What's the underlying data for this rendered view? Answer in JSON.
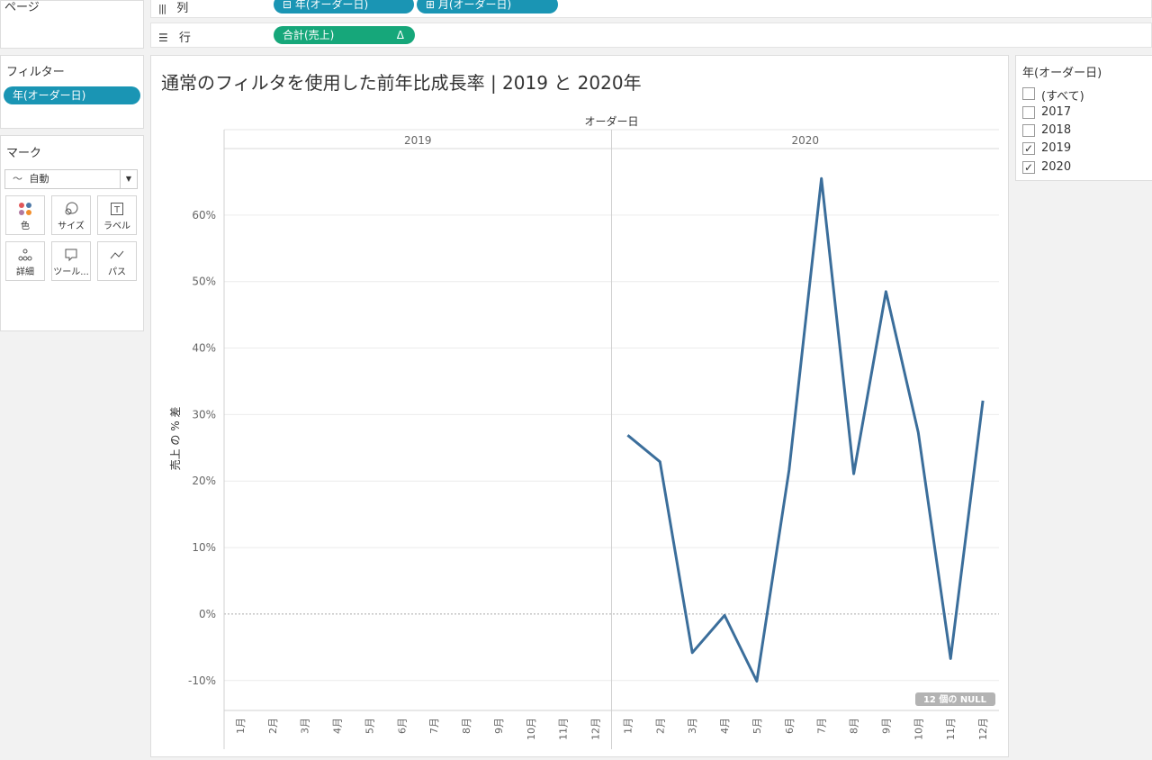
{
  "shelves": {
    "pages_label": "ページ",
    "columns_label": "列",
    "rows_label": "行",
    "column_pills": [
      "年(オーダー日)",
      "月(オーダー日)"
    ],
    "row_pill": "合計(売上)",
    "row_pill_delta": "Δ"
  },
  "filters": {
    "title": "フィルター",
    "pill": "年(オーダー日)"
  },
  "marks": {
    "title": "マーク",
    "type_selected": "自動",
    "buttons": [
      {
        "label": "色",
        "icon": "color-dots-icon"
      },
      {
        "label": "サイズ",
        "icon": "size-icon"
      },
      {
        "label": "ラベル",
        "icon": "label-icon"
      },
      {
        "label": "詳細",
        "icon": "detail-icon"
      },
      {
        "label": "ツール...",
        "icon": "tooltip-icon"
      },
      {
        "label": "パス",
        "icon": "path-icon"
      }
    ]
  },
  "quick_filter": {
    "title": "年(オーダー日)",
    "options": [
      {
        "label": "(すべて)",
        "checked": false
      },
      {
        "label": "2017",
        "checked": false
      },
      {
        "label": "2018",
        "checked": false
      },
      {
        "label": "2019",
        "checked": true
      },
      {
        "label": "2020",
        "checked": true
      }
    ]
  },
  "worksheet": {
    "title": "通常のフィルタを使用した前年比成長率 | 2019 と 2020年"
  },
  "chart_data": {
    "type": "line",
    "column_header_title": "オーダー日",
    "panes": [
      "2019",
      "2020"
    ],
    "categories": [
      "1月",
      "2月",
      "3月",
      "4月",
      "5月",
      "6月",
      "7月",
      "8月",
      "9月",
      "10月",
      "11月",
      "12月"
    ],
    "ylabel": "売上 の % 差",
    "yticks": [
      60,
      50,
      40,
      30,
      20,
      10,
      0,
      -10
    ],
    "ytick_labels": [
      "60%",
      "50%",
      "40%",
      "30%",
      "20%",
      "10%",
      "0%",
      "-10%"
    ],
    "ylim": [
      -14.5,
      70
    ],
    "zero_line": true,
    "grid": true,
    "series": [
      {
        "color": "#3b6e9b",
        "values_2019": [
          null,
          null,
          null,
          null,
          null,
          null,
          null,
          null,
          null,
          null,
          null,
          null
        ],
        "values_2020": [
          26.9,
          22.9,
          -5.8,
          -0.2,
          -10.1,
          21.7,
          65.5,
          21.1,
          48.5,
          27.3,
          -6.7,
          32.1
        ]
      }
    ],
    "null_indicator": "12 個の NULL"
  }
}
